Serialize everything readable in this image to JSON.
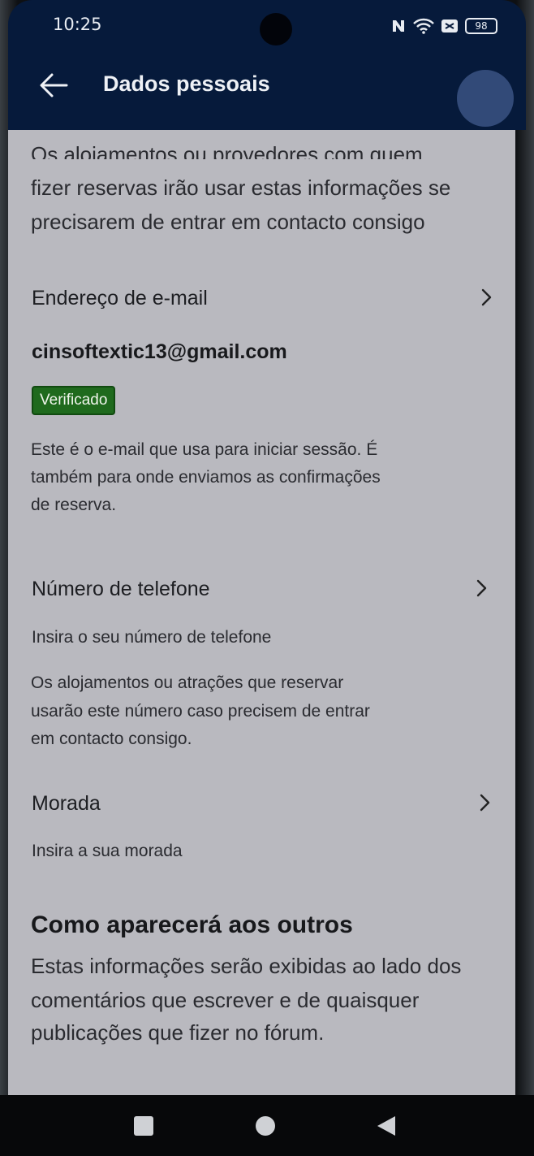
{
  "status_bar": {
    "time": "10:25",
    "battery": "98"
  },
  "app_bar": {
    "title": "Dados pessoais"
  },
  "intro": {
    "line0": "Os alojamentos ou provedores com quem",
    "line1": "fizer reservas irão usar estas informações se",
    "line2": "precisarem de entrar em contacto consigo"
  },
  "email": {
    "label": "Endereço de e-mail",
    "value": "cinsoftextic13@gmail.com",
    "badge": "Verificado",
    "desc1": "Este é o e-mail que usa para iniciar sessão. É",
    "desc2": "também para onde enviamos as confirmações",
    "desc3": "de reserva."
  },
  "phone": {
    "label": "Número de telefone",
    "placeholder": "Insira o seu número de telefone",
    "desc1": "Os alojamentos ou atrações que reservar",
    "desc2": "usarão este número caso precisem de entrar",
    "desc3": "em contacto consigo."
  },
  "address": {
    "label": "Morada",
    "placeholder": "Insira a sua morada"
  },
  "public_section": {
    "heading": "Como aparecerá aos outros",
    "desc1": "Estas informações serão exibidas ao lado dos",
    "desc2": "comentários que escrever e de quaisquer",
    "desc3": "publicações que fizer no fórum."
  },
  "icons": {
    "back": "arrow-left-icon",
    "chevron": "chevron-right-icon",
    "avatar": "avatar-icon",
    "recents": "square-recents-icon",
    "home": "circle-home-icon",
    "nav_back": "triangle-back-icon"
  }
}
